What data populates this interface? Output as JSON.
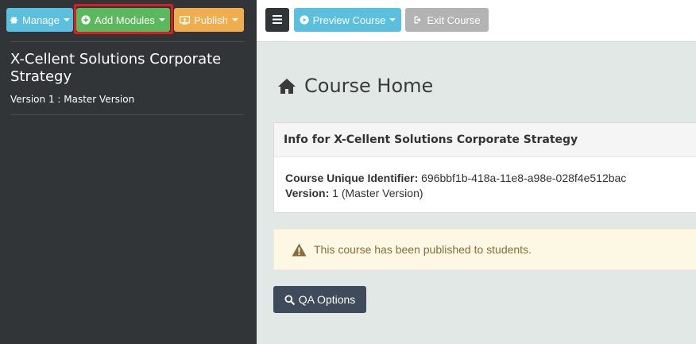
{
  "sidebar": {
    "toolbar": {
      "manage": {
        "label": "Manage",
        "icon": "gear-icon"
      },
      "add_modules": {
        "label": "Add Modules",
        "icon": "plus-circle-icon"
      },
      "publish": {
        "label": "Publish",
        "icon": "publish-icon"
      }
    },
    "course_title": "X-Cellent Solutions Corporate Strategy",
    "course_version": "Version 1 : Master Version"
  },
  "topbar": {
    "menu_icon": "hamburger-icon",
    "preview": {
      "label": "Preview Course",
      "icon": "play-circle-icon"
    },
    "exit": {
      "label": "Exit Course",
      "icon": "sign-out-icon"
    }
  },
  "main": {
    "page_title": "Course Home",
    "page_icon": "home-icon",
    "info_panel": {
      "heading": "Info for X-Cellent Solutions Corporate Strategy",
      "identifier_label": "Course Unique Identifier:",
      "identifier_value": "696bbf1b-418a-11e8-a98e-028f4e512bac",
      "version_label": "Version:",
      "version_value": "1 (Master Version)"
    },
    "alert": {
      "icon": "warning-icon",
      "text": "This course has been published to students."
    },
    "qa_button": {
      "label": "QA Options",
      "icon": "search-icon"
    }
  },
  "colors": {
    "sidebar_bg": "#323538",
    "manage": "#5bc0de",
    "add_modules": "#5cb85c",
    "publish": "#f0ad4e",
    "highlight": "#e11b22",
    "main_bg": "#e1e8e5",
    "alert_bg": "#fcf8e3",
    "qa_button": "#3f4a5a"
  }
}
